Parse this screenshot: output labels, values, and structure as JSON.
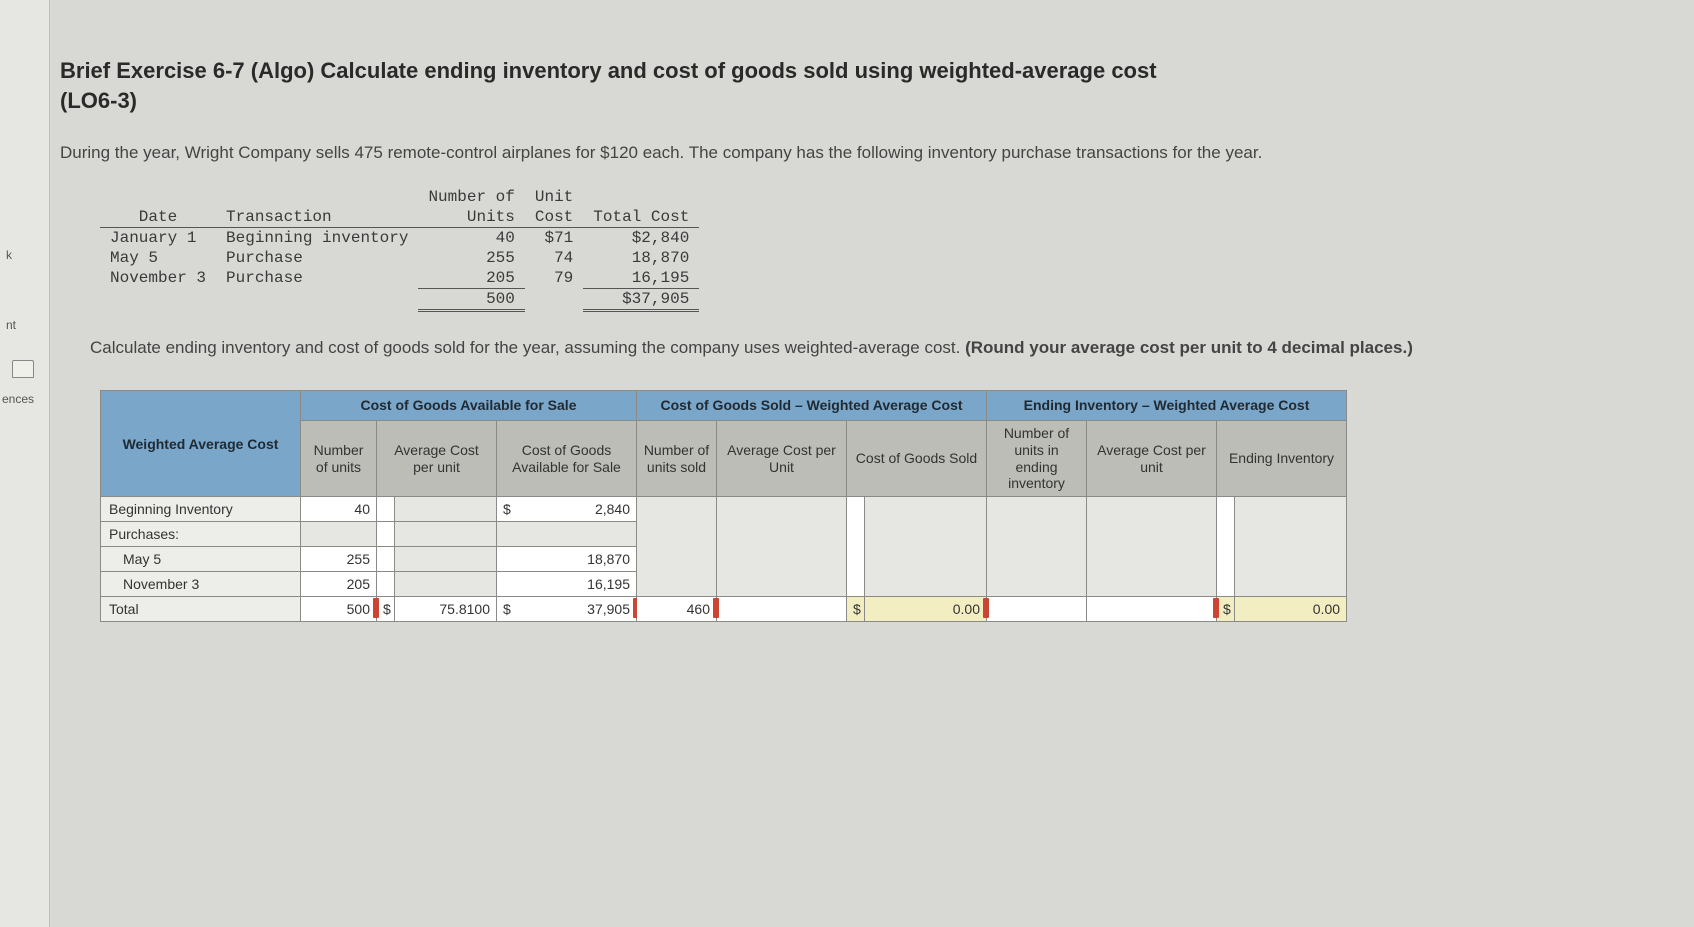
{
  "sidebar": {
    "tab_k": "k",
    "tab_nt": "nt",
    "tab_ences": "ences"
  },
  "title_line1": "Brief Exercise 6-7 (Algo) Calculate ending inventory and cost of goods sold using weighted-average cost",
  "title_line2": "(LO6-3)",
  "intro": "During the year, Wright Company sells 475 remote-control airplanes for $120 each. The company has the following inventory purchase transactions for the year.",
  "mono": {
    "headers": {
      "date": "Date",
      "transaction": "Transaction",
      "num_units_1": "Number of",
      "num_units_2": "Units",
      "unit_cost_1": "Unit",
      "unit_cost_2": "Cost",
      "total_cost": "Total Cost"
    },
    "rows": [
      {
        "date": "January 1",
        "trans": "Beginning inventory",
        "units": "40",
        "cost": "$71",
        "total": "$2,840"
      },
      {
        "date": "May 5",
        "trans": "Purchase",
        "units": "255",
        "cost": "74",
        "total": "18,870"
      },
      {
        "date": "November 3",
        "trans": "Purchase",
        "units": "205",
        "cost": "79",
        "total": "16,195"
      }
    ],
    "totals": {
      "units": "500",
      "total": "$37,905"
    }
  },
  "prompt_plain": "Calculate ending inventory and cost of goods sold for the year, assuming the company uses weighted-average cost. ",
  "prompt_bold": "(Round your average cost per unit to 4 decimal places.)",
  "sheet": {
    "row_header_label": "Weighted Average Cost",
    "groups": {
      "available": "Cost of Goods Available for Sale",
      "cogs": "Cost of Goods Sold – Weighted Average Cost",
      "ending": "Ending Inventory – Weighted Average Cost"
    },
    "sub": {
      "num_units": "Number of units",
      "avg_cost": "Average Cost per unit",
      "cogas": "Cost of Goods Available for Sale",
      "units_sold": "Number of units sold",
      "avg_cost_unit": "Average Cost per Unit",
      "cogs": "Cost of Goods Sold",
      "units_end": "Number of units in ending inventory",
      "avg_cost2": "Average Cost per unit",
      "end_inv": "Ending Inventory"
    },
    "rows": {
      "beginning": {
        "label": "Beginning Inventory",
        "units": "40",
        "amount": "2,840"
      },
      "purchases_label": "Purchases:",
      "may5": {
        "label": "May 5",
        "units": "255",
        "amount": "18,870"
      },
      "nov3": {
        "label": "November 3",
        "units": "205",
        "amount": "16,195"
      },
      "total": {
        "label": "Total",
        "units": "500",
        "avg": "75.8100",
        "amount": "37,905",
        "units_sold": "460",
        "cogs": "0.00",
        "end_inv": "0.00"
      }
    },
    "dollar": "$"
  },
  "chart_data": {
    "type": "table",
    "title": "Inventory purchase transactions and weighted-average cost worksheet",
    "transactions": [
      {
        "date": "January 1",
        "transaction": "Beginning inventory",
        "number_of_units": 40,
        "unit_cost": 71,
        "total_cost": 2840
      },
      {
        "date": "May 5",
        "transaction": "Purchase",
        "number_of_units": 255,
        "unit_cost": 74,
        "total_cost": 18870
      },
      {
        "date": "November 3",
        "transaction": "Purchase",
        "number_of_units": 205,
        "unit_cost": 79,
        "total_cost": 16195
      }
    ],
    "transaction_totals": {
      "number_of_units": 500,
      "total_cost": 37905
    },
    "worksheet": {
      "cost_of_goods_available_for_sale": {
        "beginning_inventory": {
          "number_of_units": 40,
          "cost": 2840
        },
        "purchases": [
          {
            "date": "May 5",
            "number_of_units": 255,
            "cost": 18870
          },
          {
            "date": "November 3",
            "number_of_units": 205,
            "cost": 16195
          }
        ],
        "total": {
          "number_of_units": 500,
          "average_cost_per_unit": 75.81,
          "cost": 37905
        }
      },
      "cost_of_goods_sold_weighted_average": {
        "number_of_units_sold": 460,
        "cost_of_goods_sold": 0.0
      },
      "ending_inventory_weighted_average": {
        "ending_inventory": 0.0
      }
    }
  }
}
